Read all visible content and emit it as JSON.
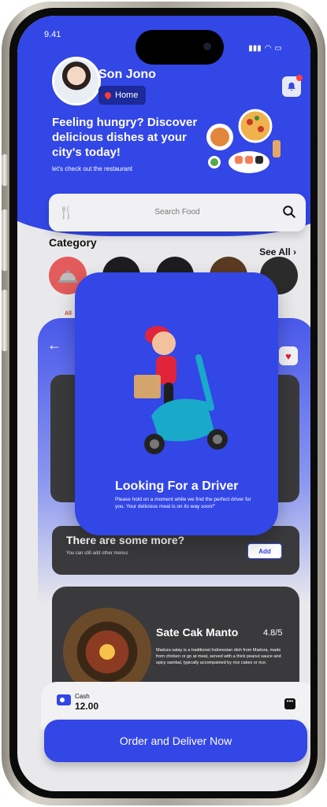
{
  "status_bar": {
    "time": "9.41"
  },
  "header": {
    "user_name": "Son Jono",
    "location": "Home",
    "headline": "Feeling hungry? Discover delicious dishes at your city's today!",
    "subtext": "let's check out the restaurant"
  },
  "search": {
    "placeholder": "Search Food"
  },
  "category": {
    "title": "Category",
    "see_all": "See All",
    "items": [
      {
        "label": "All",
        "color": "#e35b5b"
      },
      {
        "label": "",
        "color": "#1d1d20"
      },
      {
        "label": "",
        "color": "#1d1d20"
      },
      {
        "label": "",
        "color": "#5b3a22"
      },
      {
        "label": "",
        "color": "#2b2b2b"
      }
    ]
  },
  "detail": {
    "more_title": "There are some more?",
    "more_sub": "You can still add other menus",
    "add_label": "Add",
    "dish_name": "Sate Cak Manto",
    "dish_rating": "4.8/5",
    "dish_desc": "Madura satay is a traditional Indonesian dish from Madura, made from chicken or go at meat, served with a thick peanut sauce and spicy sambal, typically accompanied by rice cakes or rice."
  },
  "payment": {
    "method": "Cash",
    "amount": "12.00"
  },
  "order_button": "Order and Deliver Now",
  "modal": {
    "title": "Looking For a Driver",
    "text": "Please hold on a moment while we find the perfect driver for you. Your delicious meal is on its way soon!\""
  },
  "colors": {
    "brand": "#3346e6",
    "dark_card": "#3a3a3c",
    "accent_red": "#e35b5b"
  }
}
